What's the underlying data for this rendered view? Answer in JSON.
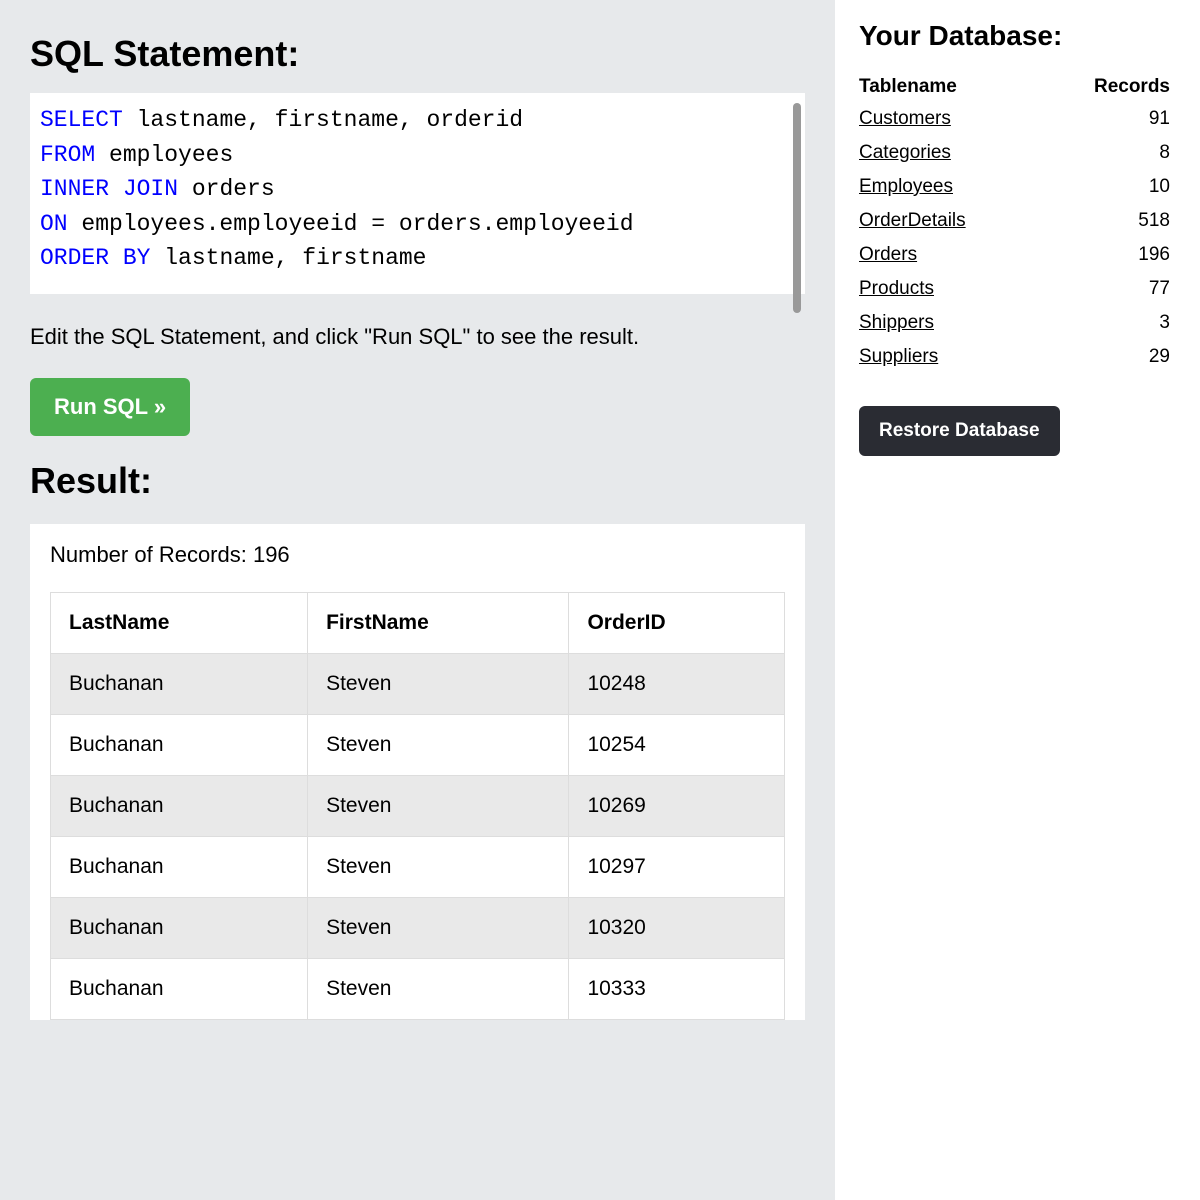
{
  "main": {
    "sql_heading": "SQL Statement:",
    "sql_tokens": [
      {
        "t": "SELECT",
        "kw": true
      },
      {
        "t": " lastname, firstname, orderid\n"
      },
      {
        "t": "FROM",
        "kw": true
      },
      {
        "t": " employees\n"
      },
      {
        "t": "INNER",
        "kw": true
      },
      {
        "t": " "
      },
      {
        "t": "JOIN",
        "kw": true
      },
      {
        "t": " orders\n"
      },
      {
        "t": "ON",
        "kw": true
      },
      {
        "t": " employees.employeeid = orders.employeeid\n"
      },
      {
        "t": "ORDER",
        "kw": true
      },
      {
        "t": " "
      },
      {
        "t": "BY",
        "kw": true
      },
      {
        "t": " lastname, firstname"
      }
    ],
    "hint": "Edit the SQL Statement, and click \"Run SQL\" to see the result.",
    "run_label": "Run SQL »",
    "result_heading": "Result:",
    "record_count_label": "Number of Records: 196",
    "result_columns": [
      "LastName",
      "FirstName",
      "OrderID"
    ],
    "result_rows": [
      [
        "Buchanan",
        "Steven",
        "10248"
      ],
      [
        "Buchanan",
        "Steven",
        "10254"
      ],
      [
        "Buchanan",
        "Steven",
        "10269"
      ],
      [
        "Buchanan",
        "Steven",
        "10297"
      ],
      [
        "Buchanan",
        "Steven",
        "10320"
      ],
      [
        "Buchanan",
        "Steven",
        "10333"
      ]
    ]
  },
  "side": {
    "heading": "Your Database:",
    "columns": [
      "Tablename",
      "Records"
    ],
    "tables": [
      {
        "name": "Customers",
        "records": 91
      },
      {
        "name": "Categories",
        "records": 8
      },
      {
        "name": "Employees",
        "records": 10
      },
      {
        "name": "OrderDetails",
        "records": 518
      },
      {
        "name": "Orders",
        "records": 196
      },
      {
        "name": "Products",
        "records": 77
      },
      {
        "name": "Shippers",
        "records": 3
      },
      {
        "name": "Suppliers",
        "records": 29
      }
    ],
    "restore_label": "Restore Database"
  }
}
